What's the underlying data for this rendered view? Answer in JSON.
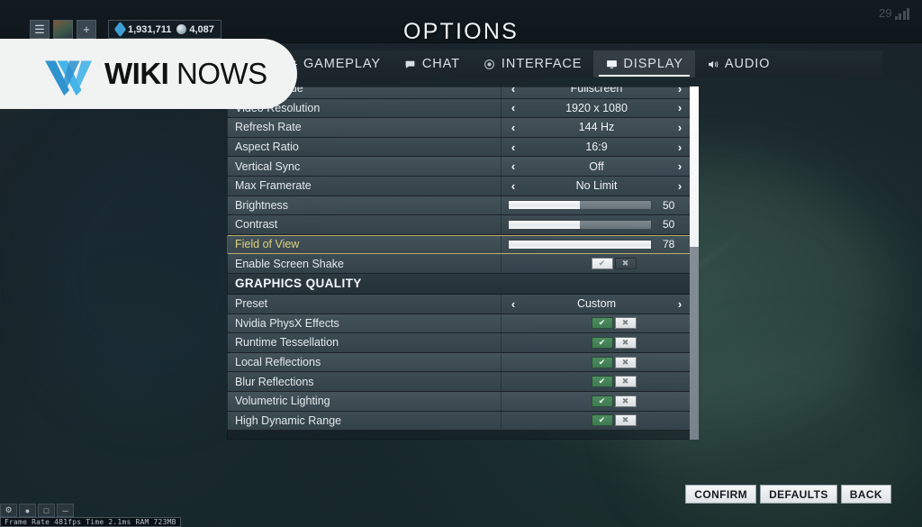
{
  "hud": {
    "menu_icon": "hamburger-menu-icon",
    "add_icon": "plus-icon",
    "avatar": "player-avatar",
    "gem_amount": "1,931,711",
    "coin_amount": "4,087",
    "ping_value": "29"
  },
  "header": {
    "title": "OPTIONS"
  },
  "tabs": [
    {
      "label": "GAMEPLAY",
      "icon": "gear-icon",
      "active": false
    },
    {
      "label": "CHAT",
      "icon": "speech-bubble-icon",
      "active": false
    },
    {
      "label": "INTERFACE",
      "icon": "target-circle-icon",
      "active": false
    },
    {
      "label": "DISPLAY",
      "icon": "monitor-icon",
      "active": true
    },
    {
      "label": "AUDIO",
      "icon": "speaker-icon",
      "active": false
    }
  ],
  "settings": {
    "rows": [
      {
        "label": "Display Mode",
        "type": "stepper",
        "value": "Fullscreen",
        "selected": false
      },
      {
        "label": "Video Resolution",
        "type": "stepper",
        "value": "1920 x 1080",
        "selected": false
      },
      {
        "label": "Refresh Rate",
        "type": "stepper",
        "value": "144 Hz",
        "selected": false
      },
      {
        "label": "Aspect Ratio",
        "type": "stepper",
        "value": "16:9",
        "selected": false
      },
      {
        "label": "Vertical Sync",
        "type": "stepper",
        "value": "Off",
        "selected": false
      },
      {
        "label": "Max Framerate",
        "type": "stepper",
        "value": "No Limit",
        "selected": false
      },
      {
        "label": "Brightness",
        "type": "slider",
        "value": "50",
        "fill_percent": 50,
        "selected": false
      },
      {
        "label": "Contrast",
        "type": "slider",
        "value": "50",
        "fill_percent": 50,
        "selected": false
      },
      {
        "label": "Field of View",
        "type": "slider",
        "value": "78",
        "fill_percent": 100,
        "selected": true
      },
      {
        "label": "Enable Screen Shake",
        "type": "toggle",
        "value": "On",
        "style": "light",
        "selected": false
      },
      {
        "label": "GRAPHICS QUALITY",
        "type": "section",
        "selected": false
      },
      {
        "label": "Preset",
        "type": "stepper",
        "value": "Custom",
        "selected": false
      },
      {
        "label": "Nvidia PhysX Effects",
        "type": "toggle",
        "value": "On",
        "style": "green",
        "selected": false
      },
      {
        "label": "Runtime Tessellation",
        "type": "toggle",
        "value": "On",
        "style": "green",
        "selected": false
      },
      {
        "label": "Local Reflections",
        "type": "toggle",
        "value": "On",
        "style": "green",
        "selected": false
      },
      {
        "label": "Blur Reflections",
        "type": "toggle",
        "value": "On",
        "style": "green",
        "selected": false
      },
      {
        "label": "Volumetric Lighting",
        "type": "toggle",
        "value": "On",
        "style": "green",
        "selected": false
      },
      {
        "label": "High Dynamic Range",
        "type": "toggle",
        "value": "On",
        "style": "green",
        "selected": false
      }
    ],
    "arrow_left": "‹",
    "arrow_right": "›",
    "toggle_on_glyph": "✔",
    "toggle_off_glyph": "✖"
  },
  "footer": {
    "confirm": "CONFIRM",
    "defaults": "DEFAULTS",
    "back": "BACK"
  },
  "debug": {
    "stats": "Frame Rate 481fps Time 2.1ms RAM 723MB",
    "icons": [
      "gear-icon",
      "person-icon",
      "window-icon",
      "minus-icon"
    ]
  },
  "watermark": {
    "primary": "WIKI",
    "secondary": "NOWS",
    "logo_color": "#3fa6dd"
  },
  "colors": {
    "accent_selected": "#ded37e",
    "toggle_green": "#4e8c5f",
    "panel_row": "#485660"
  }
}
